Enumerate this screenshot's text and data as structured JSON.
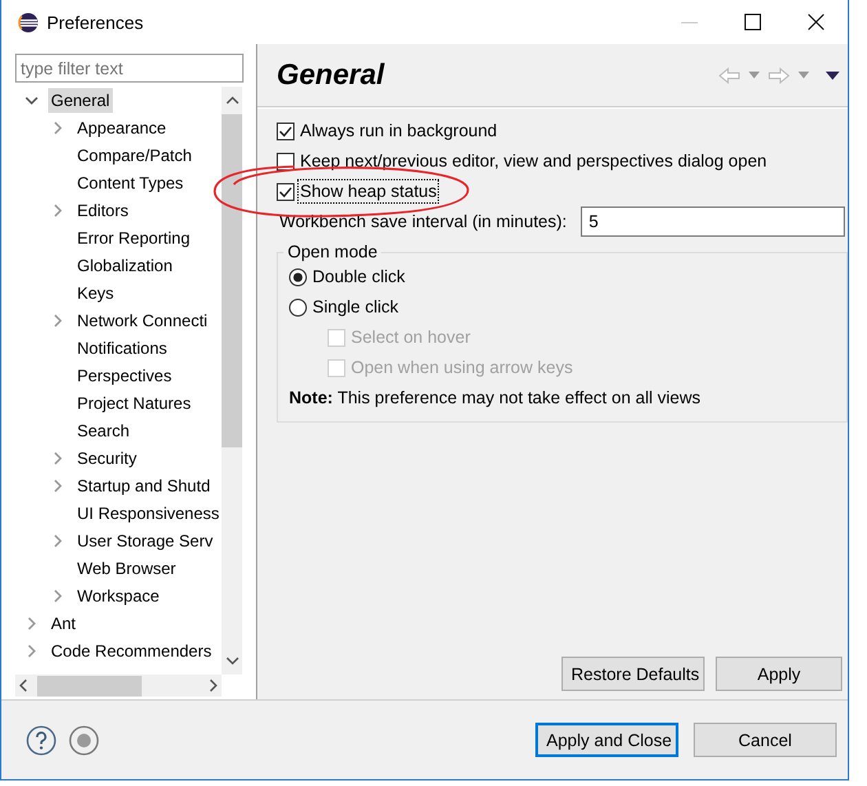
{
  "window": {
    "title": "Preferences"
  },
  "filter": {
    "placeholder": "type filter text"
  },
  "tree": [
    {
      "kind": "folder",
      "label": "General",
      "expanded": true,
      "selected": true,
      "children": [
        {
          "kind": "folder",
          "label": "Appearance",
          "expanded": false,
          "selected": false
        },
        {
          "kind": "leaf",
          "label": "Compare/Patch",
          "selected": false
        },
        {
          "kind": "leaf",
          "label": "Content Types",
          "selected": false
        },
        {
          "kind": "folder",
          "label": "Editors",
          "expanded": false,
          "selected": false
        },
        {
          "kind": "leaf",
          "label": "Error Reporting",
          "selected": false
        },
        {
          "kind": "leaf",
          "label": "Globalization",
          "selected": false
        },
        {
          "kind": "leaf",
          "label": "Keys",
          "selected": false
        },
        {
          "kind": "folder",
          "label": "Network Connecti",
          "expanded": false,
          "selected": false
        },
        {
          "kind": "leaf",
          "label": "Notifications",
          "selected": false
        },
        {
          "kind": "leaf",
          "label": "Perspectives",
          "selected": false
        },
        {
          "kind": "leaf",
          "label": "Project Natures",
          "selected": false
        },
        {
          "kind": "leaf",
          "label": "Search",
          "selected": false
        },
        {
          "kind": "folder",
          "label": "Security",
          "expanded": false,
          "selected": false
        },
        {
          "kind": "folder",
          "label": "Startup and Shutd",
          "expanded": false,
          "selected": false
        },
        {
          "kind": "leaf",
          "label": "UI Responsiveness",
          "selected": false
        },
        {
          "kind": "folder",
          "label": "User Storage Serv",
          "expanded": false,
          "selected": false
        },
        {
          "kind": "leaf",
          "label": "Web Browser",
          "selected": false
        },
        {
          "kind": "folder",
          "label": "Workspace",
          "expanded": false,
          "selected": false
        }
      ]
    },
    {
      "kind": "folder",
      "label": "Ant",
      "expanded": false,
      "selected": false
    },
    {
      "kind": "folder",
      "label": "Code Recommenders",
      "expanded": false,
      "selected": false
    }
  ],
  "page": {
    "title": "General",
    "options": [
      {
        "kind": "checkbox",
        "label": "Always run in background",
        "checked": true,
        "focused": false
      },
      {
        "kind": "checkbox",
        "label": "Keep next/previous editor, view and perspectives dialog open",
        "checked": false,
        "focused": false
      },
      {
        "kind": "checkbox",
        "label": "Show heap status",
        "checked": true,
        "focused": true
      },
      {
        "kind": "field",
        "label": "Workbench save interval (in minutes):",
        "value": "5"
      }
    ],
    "group": {
      "title": "Open mode",
      "options": [
        {
          "kind": "radio",
          "label": "Double click",
          "selected": true
        },
        {
          "kind": "radio",
          "label": "Single click",
          "selected": false
        },
        {
          "kind": "subcheckbox",
          "label": "Select on hover",
          "checked": false,
          "disabled": true
        },
        {
          "kind": "subcheckbox",
          "label": "Open when using arrow keys",
          "checked": false,
          "disabled": true
        },
        {
          "kind": "note",
          "text": "**Note:** This preference may not take effect on all views"
        }
      ]
    },
    "buttons": [
      {
        "label": "Restore Defaults"
      },
      {
        "label": "Apply"
      }
    ]
  },
  "dialog_buttons": [
    {
      "label": "Apply and Close",
      "default": true
    },
    {
      "label": "Cancel",
      "default": false
    }
  ],
  "annotations": [
    {
      "kind": "ellipse"
    }
  ]
}
